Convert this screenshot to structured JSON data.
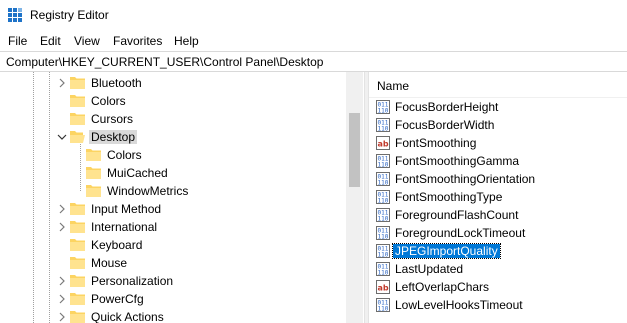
{
  "window": {
    "title": "Registry Editor"
  },
  "menu": [
    "File",
    "Edit",
    "View",
    "Favorites",
    "Help"
  ],
  "address": "Computer\\HKEY_CURRENT_USER\\Control Panel\\Desktop",
  "tree": {
    "items": [
      {
        "label": "Bluetooth",
        "expanded": false,
        "selected": false
      },
      {
        "label": "Colors",
        "expanded": false,
        "selected": false
      },
      {
        "label": "Cursors",
        "expanded": false,
        "selected": false
      },
      {
        "label": "Desktop",
        "expanded": true,
        "selected": true,
        "children": [
          {
            "label": "Colors"
          },
          {
            "label": "MuiCached"
          },
          {
            "label": "WindowMetrics"
          }
        ]
      },
      {
        "label": "Input Method",
        "expanded": false,
        "selected": false
      },
      {
        "label": "International",
        "expanded": false,
        "selected": false
      },
      {
        "label": "Keyboard",
        "expanded": false,
        "selected": false
      },
      {
        "label": "Mouse",
        "expanded": false,
        "selected": false
      },
      {
        "label": "Personalization",
        "expanded": false,
        "selected": false
      },
      {
        "label": "PowerCfg",
        "expanded": false,
        "selected": false
      },
      {
        "label": "Quick Actions",
        "expanded": false,
        "selected": false
      }
    ]
  },
  "values": {
    "column_name": "Name",
    "items": [
      {
        "name": "FocusBorderHeight",
        "icon": "dword-icon",
        "selected": false
      },
      {
        "name": "FocusBorderWidth",
        "icon": "dword-icon",
        "selected": false
      },
      {
        "name": "FontSmoothing",
        "icon": "string-icon",
        "selected": false
      },
      {
        "name": "FontSmoothingGamma",
        "icon": "dword-icon",
        "selected": false
      },
      {
        "name": "FontSmoothingOrientation",
        "icon": "dword-icon",
        "selected": false
      },
      {
        "name": "FontSmoothingType",
        "icon": "dword-icon",
        "selected": false
      },
      {
        "name": "ForegroundFlashCount",
        "icon": "dword-icon",
        "selected": false
      },
      {
        "name": "ForegroundLockTimeout",
        "icon": "dword-icon",
        "selected": false
      },
      {
        "name": "JPEGImportQuality",
        "icon": "dword-icon",
        "selected": true
      },
      {
        "name": "LastUpdated",
        "icon": "dword-icon",
        "selected": false
      },
      {
        "name": "LeftOverlapChars",
        "icon": "string-icon",
        "selected": false
      },
      {
        "name": "LowLevelHooksTimeout",
        "icon": "dword-icon",
        "selected": false
      }
    ]
  },
  "colors": {
    "selection": "#0078d7",
    "tree_selection": "#d9d9d9",
    "folder": "#fcd462",
    "app_icon": "#1e73c8"
  }
}
